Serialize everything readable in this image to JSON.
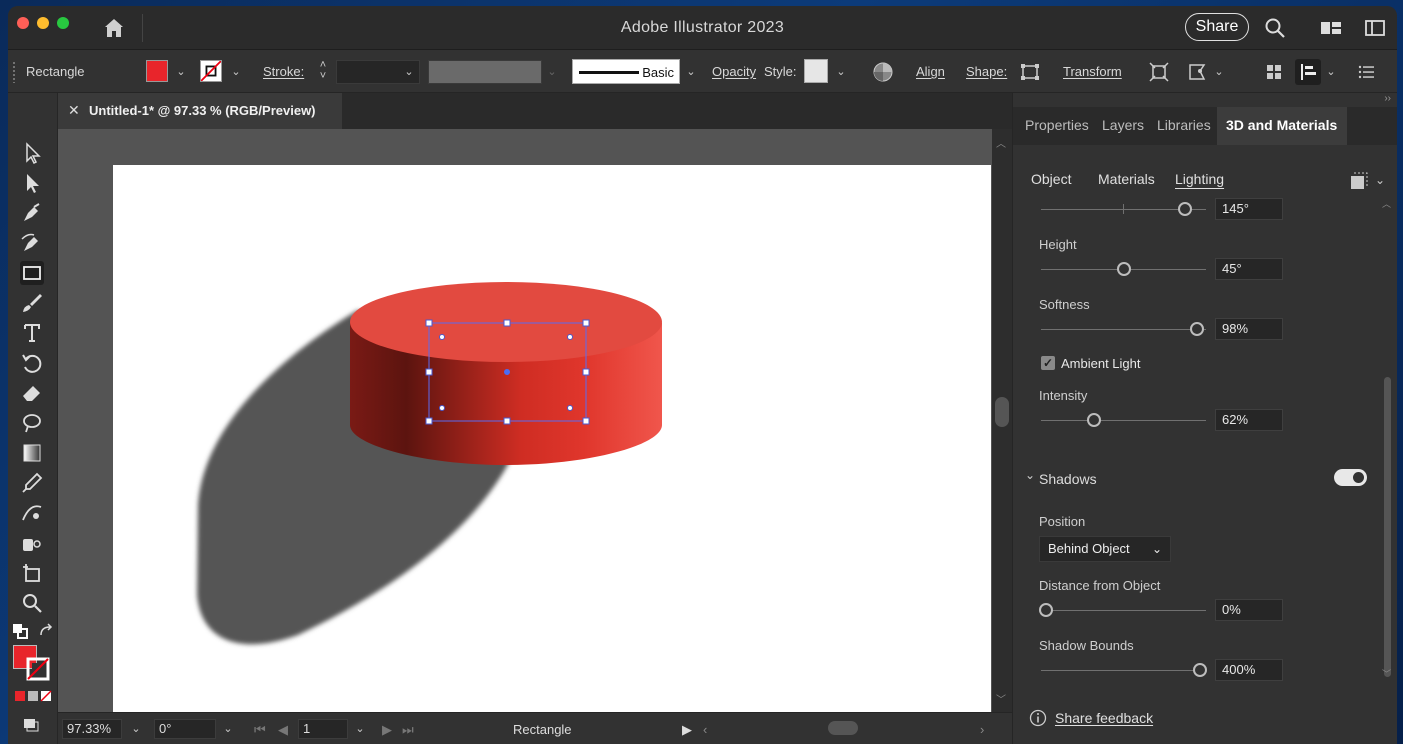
{
  "app": {
    "title": "Adobe Illustrator 2023",
    "share_label": "Share"
  },
  "controlbar": {
    "selection_type": "Rectangle",
    "fill_color": "#e8252b",
    "stroke_label": "Stroke:",
    "brush_definition": "Basic",
    "opacity_label": "Opacity",
    "style_label": "Style:",
    "align_label": "Align",
    "shape_label": "Shape:",
    "transform_label": "Transform"
  },
  "document": {
    "tab_title": "Untitled-1* @ 97.33 % (RGB/Preview)",
    "close": "✕"
  },
  "statusbar": {
    "zoom": "97.33%",
    "rotation": "0°",
    "artboard": "1",
    "tool": "Rectangle"
  },
  "panel": {
    "tabs": [
      "Properties",
      "Layers",
      "Libraries",
      "3D and Materials"
    ],
    "active_tab": "3D and Materials",
    "subtabs": [
      "Object",
      "Materials",
      "Lighting"
    ],
    "active_subtab": "Lighting",
    "rotation": {
      "value": "145°",
      "level": 0.9
    },
    "height": {
      "label": "Height",
      "value": "45°",
      "level": 0.5
    },
    "softness": {
      "label": "Softness",
      "value": "98%",
      "level": 0.98
    },
    "ambient_light": {
      "label": "Ambient Light",
      "checked": true
    },
    "intensity": {
      "label": "Intensity",
      "value": "62%",
      "level": 0.32
    },
    "shadows": {
      "label": "Shadows",
      "enabled": true,
      "position_label": "Position",
      "position_value": "Behind Object",
      "distance": {
        "label": "Distance from Object",
        "value": "0%",
        "level": 0
      },
      "bounds": {
        "label": "Shadow Bounds",
        "value": "400%",
        "level": 1
      }
    },
    "feedback": "Share feedback"
  },
  "colors": {
    "object_red": "#e8352f",
    "accent": "#4a6cf7"
  }
}
